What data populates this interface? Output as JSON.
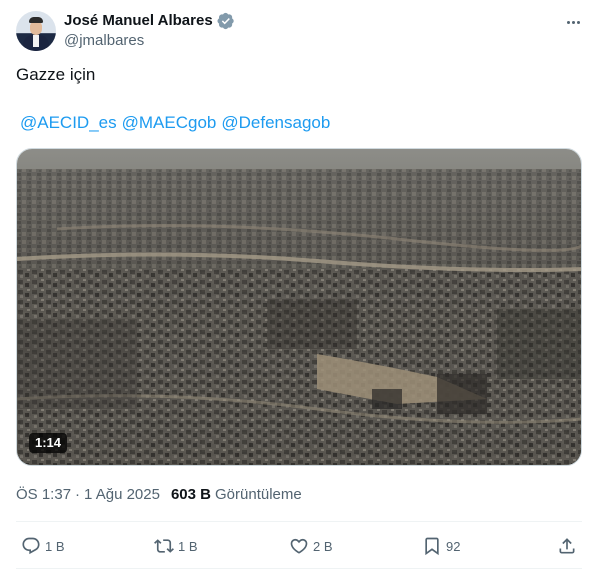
{
  "author": {
    "display_name": "José Manuel Albares",
    "handle": "@jmalbares",
    "verified": true
  },
  "tweet": {
    "text": "Gazze için",
    "mentions": [
      "@AECID_es",
      "@MAEC​gob",
      "@Defensagob"
    ]
  },
  "media": {
    "type": "video",
    "duration": "1:14",
    "description_icon": "aerial-video"
  },
  "meta": {
    "time": "ÖS 1:37",
    "date": "1 Ağu 2025",
    "views_count": "603 B",
    "views_label": "Görüntüleme"
  },
  "actions": {
    "replies": "1 B",
    "retweets": "1 B",
    "likes": "2 B",
    "bookmarks": "92"
  },
  "colors": {
    "link": "#1d9bf0",
    "secondary_text": "#536471",
    "verified_badge": "#829aab"
  }
}
